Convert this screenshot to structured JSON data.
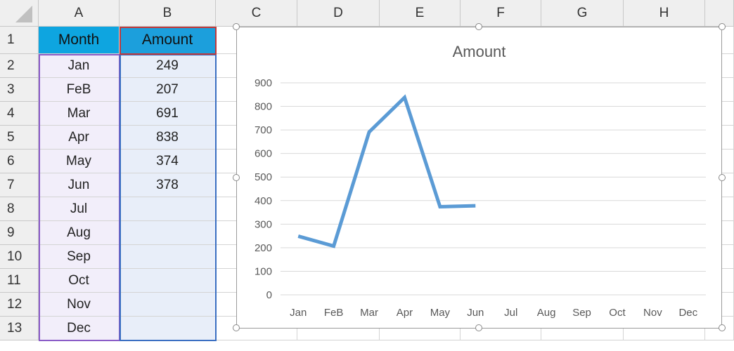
{
  "columns": [
    "A",
    "B",
    "C",
    "D",
    "E",
    "F",
    "G",
    "H"
  ],
  "rows": [
    "1",
    "2",
    "3",
    "4",
    "5",
    "6",
    "7",
    "8",
    "9",
    "10",
    "11",
    "12",
    "13"
  ],
  "table": {
    "headers": [
      "Month",
      "Amount"
    ],
    "months": [
      "Jan",
      "FeB",
      "Mar",
      "Apr",
      "May",
      "Jun",
      "Jul",
      "Aug",
      "Sep",
      "Oct",
      "Nov",
      "Dec"
    ],
    "amounts": [
      "249",
      "207",
      "691",
      "838",
      "374",
      "378",
      "",
      "",
      "",
      "",
      "",
      ""
    ]
  },
  "colors": {
    "line": "#5b9bd5",
    "header": "#0ea5e0"
  },
  "chart_data": {
    "type": "line",
    "title": "Amount",
    "categories": [
      "Jan",
      "FeB",
      "Mar",
      "Apr",
      "May",
      "Jun",
      "Jul",
      "Aug",
      "Sep",
      "Oct",
      "Nov",
      "Dec"
    ],
    "series": [
      {
        "name": "Amount",
        "values": [
          249,
          207,
          691,
          838,
          374,
          378,
          null,
          null,
          null,
          null,
          null,
          null
        ]
      }
    ],
    "yticks": [
      "0",
      "100",
      "200",
      "300",
      "400",
      "500",
      "600",
      "700",
      "800",
      "900"
    ],
    "ylim": [
      0,
      900
    ],
    "grid": true,
    "xlabel": "",
    "ylabel": ""
  }
}
